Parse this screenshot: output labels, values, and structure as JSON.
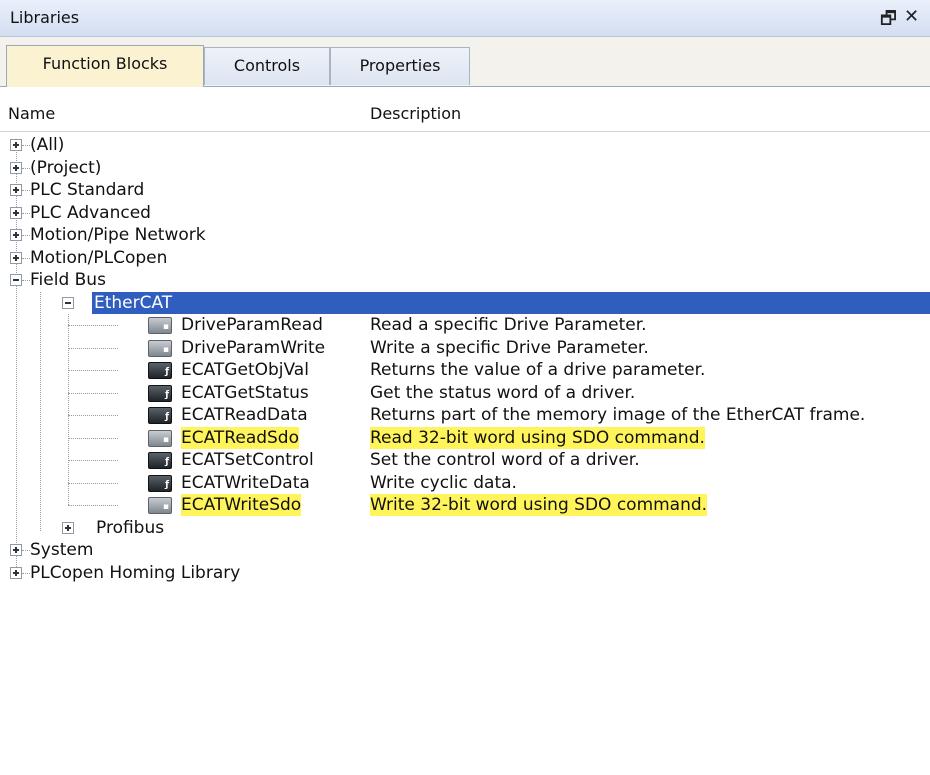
{
  "window": {
    "title": "Libraries",
    "restore_icon": "restore-icon",
    "close_icon": "close-icon",
    "restore_glyph": "🗗",
    "close_glyph": "✕"
  },
  "tabs": [
    {
      "label": "Function Blocks",
      "active": true
    },
    {
      "label": "Controls",
      "active": false
    },
    {
      "label": "Properties",
      "active": false
    }
  ],
  "columns": {
    "name": "Name",
    "description": "Description"
  },
  "tree": {
    "roots": [
      {
        "label": "(All)",
        "expanded": false
      },
      {
        "label": "(Project)",
        "expanded": false
      },
      {
        "label": "PLC Standard",
        "expanded": false
      },
      {
        "label": "PLC Advanced",
        "expanded": false
      },
      {
        "label": "Motion/Pipe Network",
        "expanded": false
      },
      {
        "label": "Motion/PLCopen",
        "expanded": false
      },
      {
        "label": "Field Bus",
        "expanded": true
      }
    ],
    "fieldbus": {
      "ethercat": {
        "label": "EtherCAT",
        "expanded": true,
        "selected": true
      },
      "profibus": {
        "label": "Profibus",
        "expanded": false
      }
    },
    "blocks": [
      {
        "name": "DriveParamRead",
        "desc": "Read a specific Drive Parameter.",
        "icon": "gray",
        "highlight": false
      },
      {
        "name": "DriveParamWrite",
        "desc": "Write a specific Drive Parameter.",
        "icon": "gray",
        "highlight": false
      },
      {
        "name": "ECATGetObjVal",
        "desc": "Returns the value of a drive parameter.",
        "icon": "dark",
        "highlight": false
      },
      {
        "name": "ECATGetStatus",
        "desc": "Get the status word of a driver.",
        "icon": "dark",
        "highlight": false
      },
      {
        "name": "ECATReadData",
        "desc": "Returns part of the memory image of the EtherCAT frame.",
        "icon": "dark",
        "highlight": false
      },
      {
        "name": "ECATReadSdo",
        "desc": "Read 32-bit word using SDO command.",
        "icon": "gray",
        "highlight": true
      },
      {
        "name": "ECATSetControl",
        "desc": "Set the control word of a driver.",
        "icon": "dark",
        "highlight": false
      },
      {
        "name": "ECATWriteData",
        "desc": "Write cyclic data.",
        "icon": "dark",
        "highlight": false
      },
      {
        "name": "ECATWriteSdo",
        "desc": "Write 32-bit word using SDO command.",
        "icon": "gray",
        "highlight": true
      }
    ],
    "tail_roots": [
      {
        "label": "System",
        "expanded": false
      },
      {
        "label": "PLCopen Homing Library",
        "expanded": false
      }
    ]
  },
  "colors": {
    "selection": "#2f5ebf",
    "highlight": "#fff55a",
    "active_tab": "#fbf2d2"
  }
}
